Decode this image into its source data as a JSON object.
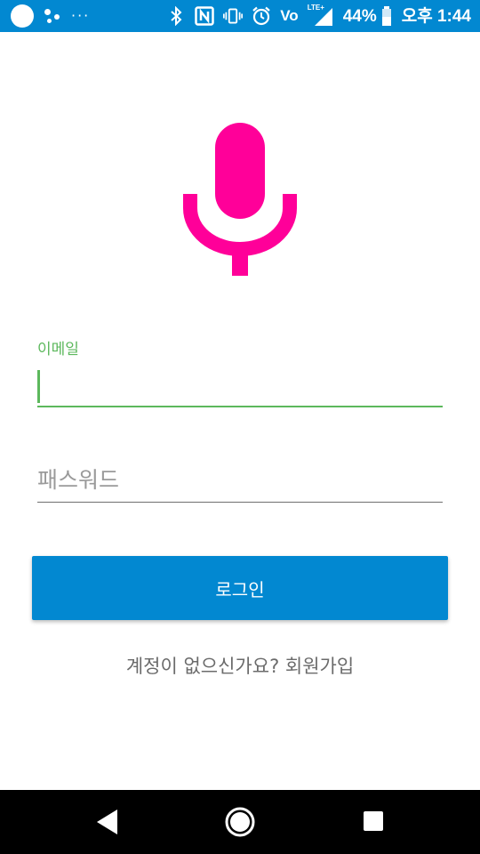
{
  "status_bar": {
    "battery_percent": "44%",
    "time": "오후 1:44",
    "volte": "Vo",
    "network": "LTE+",
    "icons": [
      "notification-circle-icon",
      "assistant-icon",
      "more-dots-icon",
      "bluetooth-icon",
      "nfc-icon",
      "vibrate-icon",
      "alarm-icon",
      "volte-icon",
      "signal-icon",
      "battery-icon"
    ],
    "more_dots": "···"
  },
  "logo": {
    "icon": "microphone-icon",
    "color": "#ff0099"
  },
  "login_form": {
    "email_label": "이메일",
    "email_value": "",
    "password_placeholder": "패스워드",
    "login_button_label": "로그인",
    "signup_text": "계정이 없으신가요? 회원가입"
  },
  "colors": {
    "primary": "#0288d1",
    "accent_green": "#5cb85c",
    "logo_pink": "#ff0099"
  },
  "nav_bar": {
    "icons": [
      "back-icon",
      "home-icon",
      "recents-icon"
    ]
  }
}
